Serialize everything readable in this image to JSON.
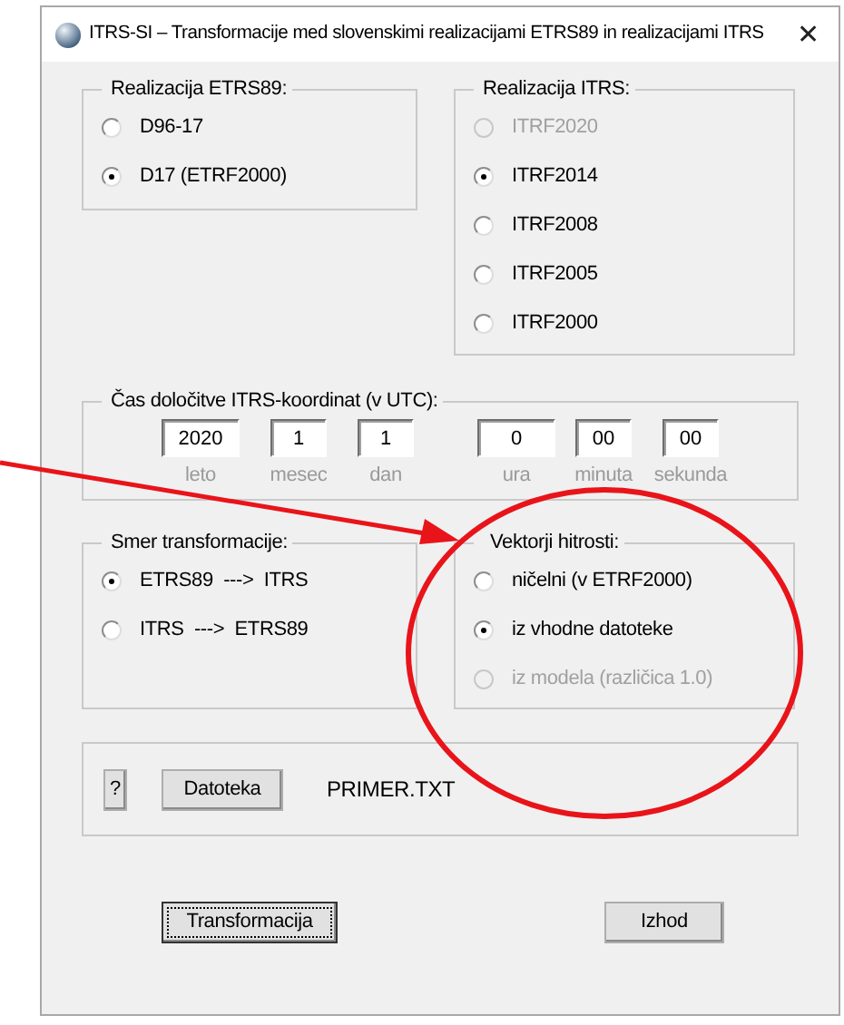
{
  "window": {
    "title": "ITRS-SI – Transformacije med slovenskimi realizacijami ETRS89 in realizacijami ITRS",
    "close": "✕"
  },
  "etrs89_group": {
    "label": "Realizacija ETRS89:",
    "options": [
      {
        "label": "D96-17",
        "selected": false,
        "disabled": false
      },
      {
        "label": "D17 (ETRF2000)",
        "selected": true,
        "disabled": false
      }
    ]
  },
  "itrs_group": {
    "label": "Realizacija ITRS:",
    "options": [
      {
        "label": "ITRF2020",
        "selected": false,
        "disabled": true
      },
      {
        "label": "ITRF2014",
        "selected": true,
        "disabled": false
      },
      {
        "label": "ITRF2008",
        "selected": false,
        "disabled": false
      },
      {
        "label": "ITRF2005",
        "selected": false,
        "disabled": false
      },
      {
        "label": "ITRF2000",
        "selected": false,
        "disabled": false
      }
    ]
  },
  "time_group": {
    "label": "Čas določitve ITRS-koordinat (v UTC):",
    "date_fields": [
      {
        "value": "2020",
        "caption": "leto"
      },
      {
        "value": "1",
        "caption": "mesec"
      },
      {
        "value": "1",
        "caption": "dan"
      }
    ],
    "time_fields": [
      {
        "value": "0",
        "caption": "ura"
      },
      {
        "value": "00",
        "caption": "minuta"
      },
      {
        "value": "00",
        "caption": "sekunda"
      }
    ]
  },
  "direction_group": {
    "label": "Smer transformacije:",
    "options": [
      {
        "label": "ETRS89  --->  ITRS",
        "selected": true,
        "disabled": false
      },
      {
        "label": "ITRS  --->  ETRS89",
        "selected": false,
        "disabled": false
      }
    ]
  },
  "velocity_group": {
    "label": "Vektorji hitrosti:",
    "options": [
      {
        "label": "ničelni (v ETRF2000)",
        "selected": false,
        "disabled": false
      },
      {
        "label": "iz vhodne datoteke",
        "selected": true,
        "disabled": false
      },
      {
        "label": "iz modela (različica 1.0)",
        "selected": false,
        "disabled": true
      }
    ]
  },
  "file_group": {
    "help_button": "?",
    "file_button": "Datoteka",
    "file_name": "PRIMER.TXT"
  },
  "buttons": [
    {
      "label": "Transformacija",
      "focused": true
    },
    {
      "label": "Izhod",
      "focused": false
    }
  ]
}
